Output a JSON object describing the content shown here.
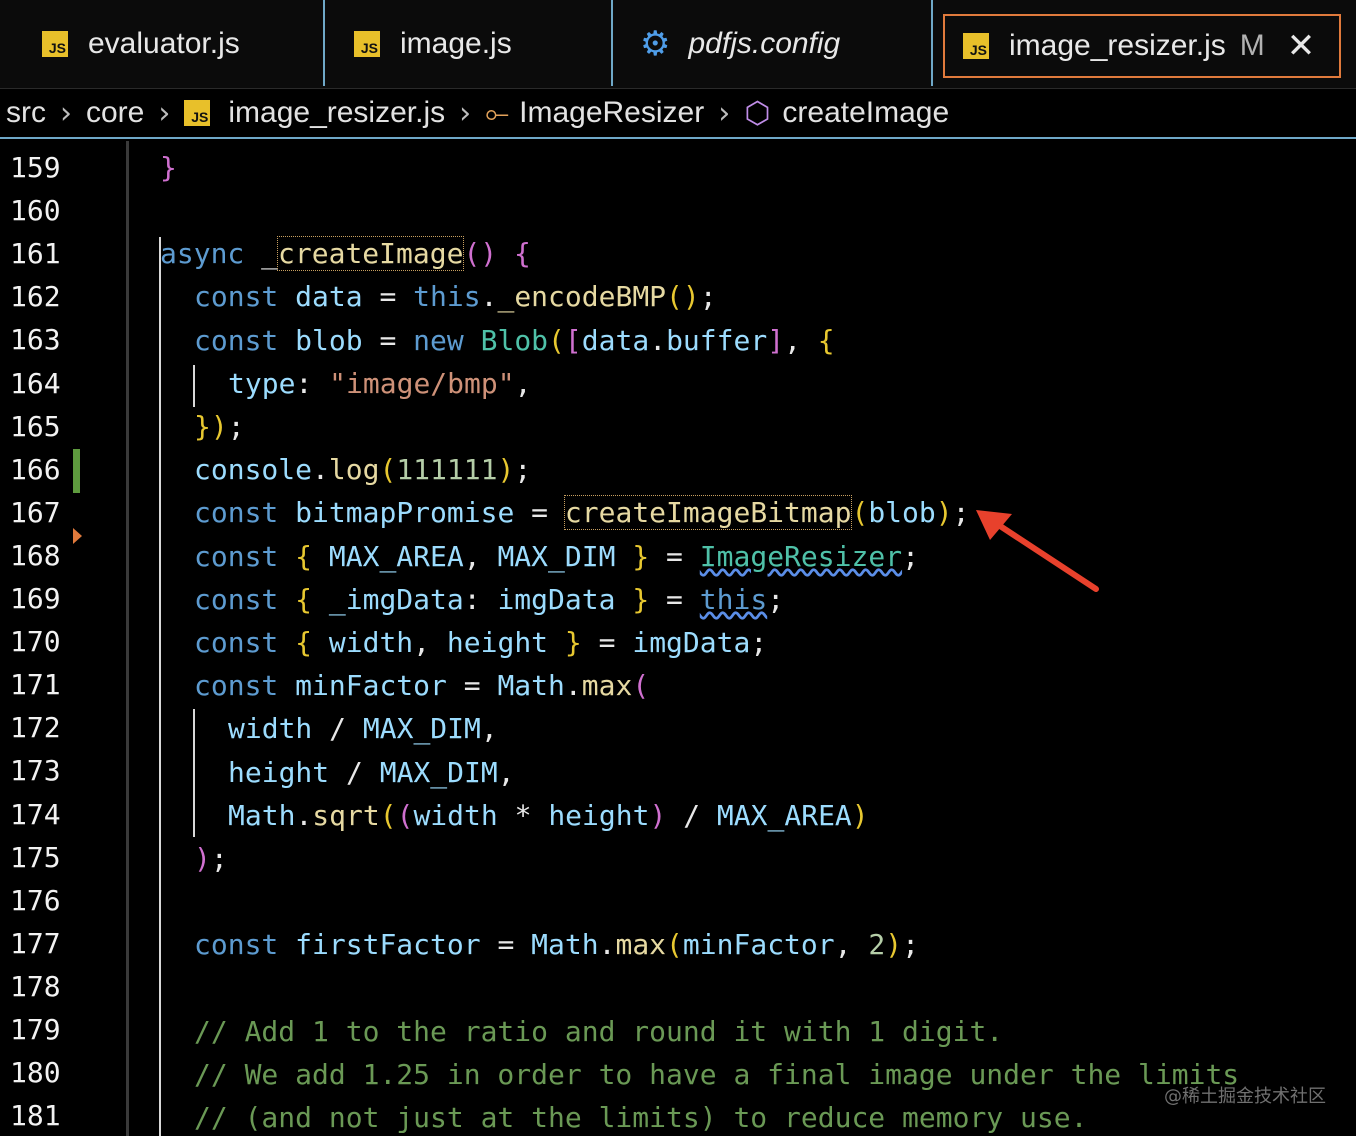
{
  "tabs": [
    {
      "label": "evaluator.js",
      "icon": "js-file-icon",
      "active": false
    },
    {
      "label": "image.js",
      "icon": "js-file-icon",
      "active": false
    },
    {
      "label": "pdfjs.config",
      "icon": "gear-icon",
      "active": false
    },
    {
      "label": "image_resizer.js",
      "icon": "js-file-icon",
      "active": true,
      "modified": "M"
    }
  ],
  "breadcrumb": {
    "items": [
      "src",
      "core",
      "image_resizer.js",
      "ImageResizer",
      "createImage"
    ]
  },
  "editor": {
    "line_numbers": [
      "159",
      "160",
      "161",
      "162",
      "163",
      "164",
      "165",
      "166",
      "167",
      "168",
      "169",
      "170",
      "171",
      "172",
      "173",
      "174",
      "175",
      "176",
      "177",
      "178",
      "179",
      "180",
      "181"
    ],
    "annotation": "red-arrow pointing at createImageBitmap(blob) line 167"
  },
  "watermark": "@稀土掘金技术社区",
  "colors": {
    "keyword": "#5d9bd0",
    "function": "#e6d9a2",
    "class": "#4fc1a8",
    "string": "#ce9178",
    "number": "#b5cea8",
    "variable": "#9cdcfe",
    "comment": "#6a9955",
    "active_tab_border": "#e07a3c",
    "arrow": "#e8412c"
  }
}
